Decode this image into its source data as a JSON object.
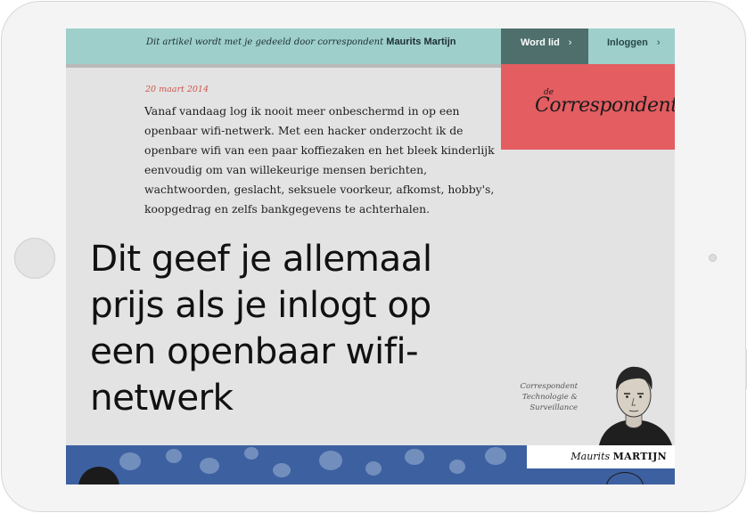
{
  "top_bar": {
    "share_prefix": "Dit artikel wordt met je gedeeld door correspondent",
    "share_name": "Maurits Martijn",
    "join_label": "Word lid",
    "login_label": "Inloggen",
    "chevron": "›"
  },
  "logo": {
    "small": "de",
    "main": "Correspondent"
  },
  "article": {
    "date": "20 maart 2014",
    "intro": "Vanaf vandaag log ik nooit meer onbeschermd in op een openbaar wifi-netwerk. Met een hacker onderzocht ik de openbare wifi van een paar koffiezaken en het bleek kinderlijk eenvoudig om van willekeurige mensen berichten, wachtwoorden, geslacht, seksuele voorkeur, afkomst, hobby's, koopgedrag en zelfs bankgegevens te achterhalen.",
    "headline": "Dit geef je allemaal prijs als je inlogt op een openbaar wifi-netwerk"
  },
  "author": {
    "role_line1": "Correspondent",
    "role_line2": "Technologie &",
    "role_line3": "Surveillance",
    "first_name": "Maurits",
    "last_name": "MARTIJN"
  },
  "colors": {
    "teal": "#9ecfcb",
    "dark_teal": "#4e6f6c",
    "logo_red": "#e35d61",
    "date_red": "#d0554d",
    "banner_blue": "#3d60a0"
  }
}
